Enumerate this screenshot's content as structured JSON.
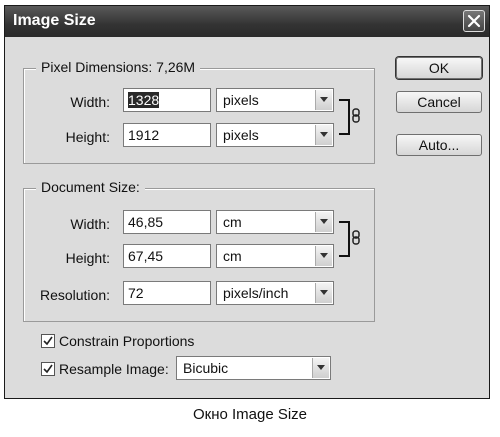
{
  "window": {
    "title": "Image Size",
    "close_icon": "close-icon"
  },
  "pixel_dimensions": {
    "legend": "Pixel Dimensions:",
    "size": "7,26M",
    "width_label": "Width:",
    "width_value": "1328",
    "width_unit": "pixels",
    "height_label": "Height:",
    "height_value": "1912",
    "height_unit": "pixels",
    "link_icon": "chain-link-icon"
  },
  "document_size": {
    "legend": "Document Size:",
    "width_label": "Width:",
    "width_value": "46,85",
    "width_unit": "cm",
    "height_label": "Height:",
    "height_value": "67,45",
    "height_unit": "cm",
    "resolution_label": "Resolution:",
    "resolution_value": "72",
    "resolution_unit": "pixels/inch",
    "link_icon": "chain-link-icon"
  },
  "options": {
    "constrain_label": "Constrain Proportions",
    "constrain_checked": true,
    "resample_label": "Resample Image:",
    "resample_checked": true,
    "resample_method": "Bicubic"
  },
  "buttons": {
    "ok": "OK",
    "cancel": "Cancel",
    "auto": "Auto..."
  },
  "caption": "Окно Image Size"
}
